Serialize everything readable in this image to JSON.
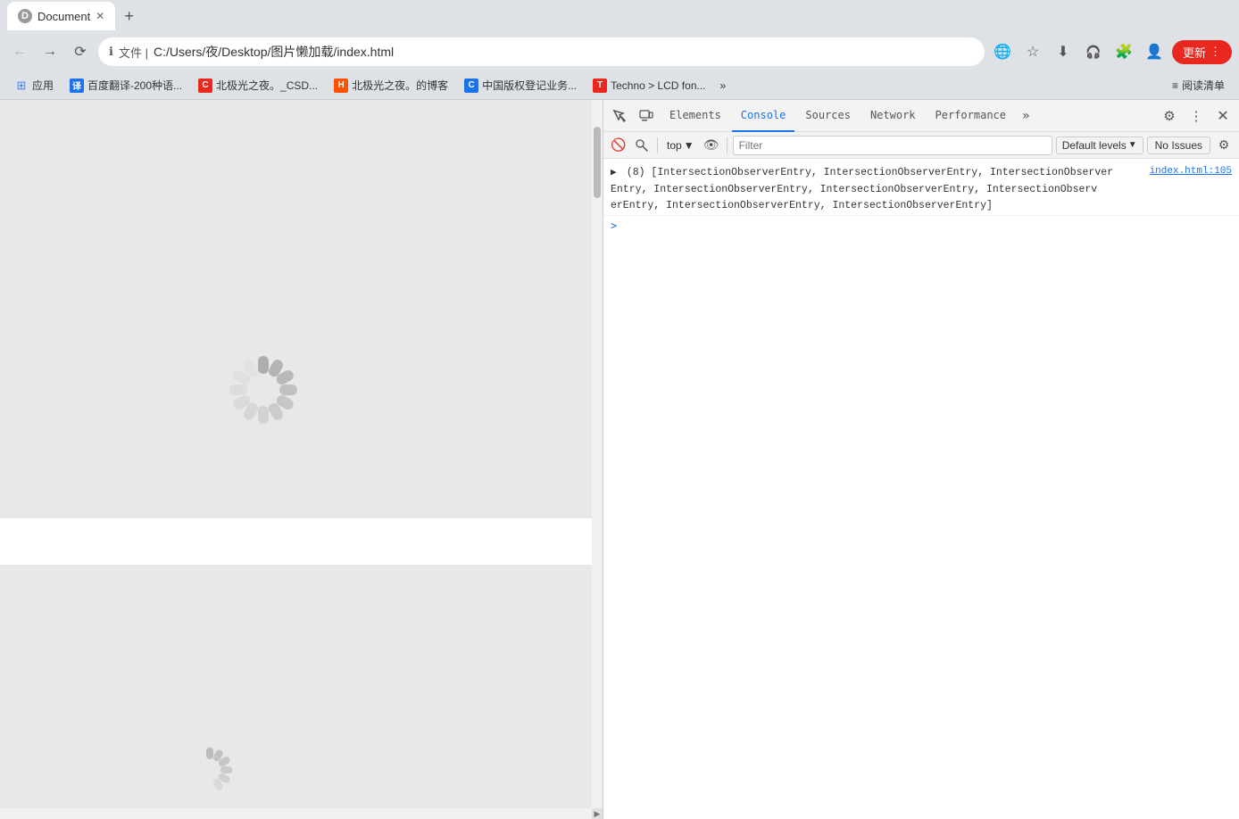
{
  "browser": {
    "tab": {
      "title": "Document",
      "favicon": "D"
    },
    "url": "C:/Users/夜/Desktop/图片懒加载/index.html",
    "update_btn": "更新",
    "bookmarks": [
      {
        "label": "应用",
        "icon": "grid",
        "type": "apps"
      },
      {
        "label": "百度翻译-200种语...",
        "icon": "译",
        "color": "#1a73e8",
        "bg": "#e8f0fe"
      },
      {
        "label": "北极光之夜。_CSD...",
        "icon": "C",
        "color": "#e8271e",
        "bg": "#fce8e6"
      },
      {
        "label": "北极光之夜。的博客",
        "icon": "H",
        "color": "#ff4f00",
        "bg": "#ff4f00"
      },
      {
        "label": "中国版权登记业务...",
        "icon": "C",
        "color": "#1a73e8",
        "bg": "#e3f2fd"
      },
      {
        "label": "Techno > LCD fon...",
        "icon": "T",
        "color": "#e8271e",
        "bg": "#fce8e6"
      },
      {
        "label": "阅读清单",
        "icon": "≡",
        "color": "#555"
      }
    ]
  },
  "devtools": {
    "tabs": [
      {
        "label": "Elements",
        "active": false
      },
      {
        "label": "Console",
        "active": true
      },
      {
        "label": "Sources",
        "active": false
      },
      {
        "label": "Network",
        "active": false
      },
      {
        "label": "Performance",
        "active": false
      }
    ],
    "console": {
      "top_selector": "top",
      "filter_placeholder": "Filter",
      "default_levels": "Default levels",
      "no_issues": "No Issues",
      "log_link": "index.html:105",
      "log_text": "(8) [IntersectionObserverEntry, IntersectionObserverEntry, IntersectionObserverEntry, IntersectionObserverEntry, IntersectionObserverEntry, IntersectionObserverEntry, IntersectionObserverEntry, IntersectionObserverEntry]",
      "log_short": "(8) [IntersectionObserverEntry, IntersectionObserverEntry, IntersectionObserver▶Entry, IntersectionObserverEntry, IntersectionObserverEntry, IntersectionObserverEntry, IntersectionObserverEntry, IntersectionObserverEntry]"
    }
  }
}
